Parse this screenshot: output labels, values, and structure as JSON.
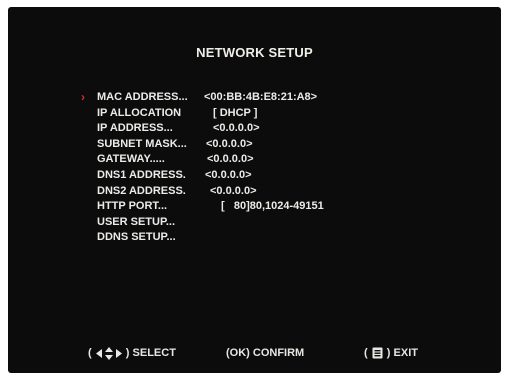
{
  "title": "NETWORK SETUP",
  "cursor_glyph": "›",
  "menu": [
    {
      "label": "MAC ADDRESS...",
      "value": "<00:BB:4B:E8:21:A8>",
      "selected": true
    },
    {
      "label": "IP ALLOCATION",
      "value": "[ DHCP ]",
      "selected": false
    },
    {
      "label": "IP ADDRESS...",
      "value": "<0.0.0.0>",
      "selected": false
    },
    {
      "label": "SUBNET MASK...",
      "value": "<0.0.0.0>",
      "selected": false
    },
    {
      "label": "GATEWAY.....",
      "value": "<0.0.0.0>",
      "selected": false
    },
    {
      "label": "DNS1 ADDRESS.",
      "value": "<0.0.0.0>",
      "selected": false
    },
    {
      "label": "DNS2 ADDRESS.",
      "value": "<0.0.0.0>",
      "selected": false
    },
    {
      "label": "HTTP PORT...",
      "value": "[   80]80,1024-49151",
      "selected": false
    },
    {
      "label": "USER SETUP...",
      "value": "",
      "selected": false
    },
    {
      "label": "DDNS SETUP...",
      "value": "",
      "selected": false
    }
  ],
  "footer": {
    "select": {
      "open": "(",
      "close": ")",
      "label": "SELECT",
      "icon": "arrow-keys-icon"
    },
    "confirm": {
      "text": "(OK) CONFIRM"
    },
    "exit": {
      "open": "(",
      "close": ")",
      "label": "EXIT",
      "icon": "menu-key-icon"
    }
  },
  "colors": {
    "screen_bg": "#0d0c0c",
    "text": "#ecebe8",
    "cursor": "#d3302a"
  }
}
